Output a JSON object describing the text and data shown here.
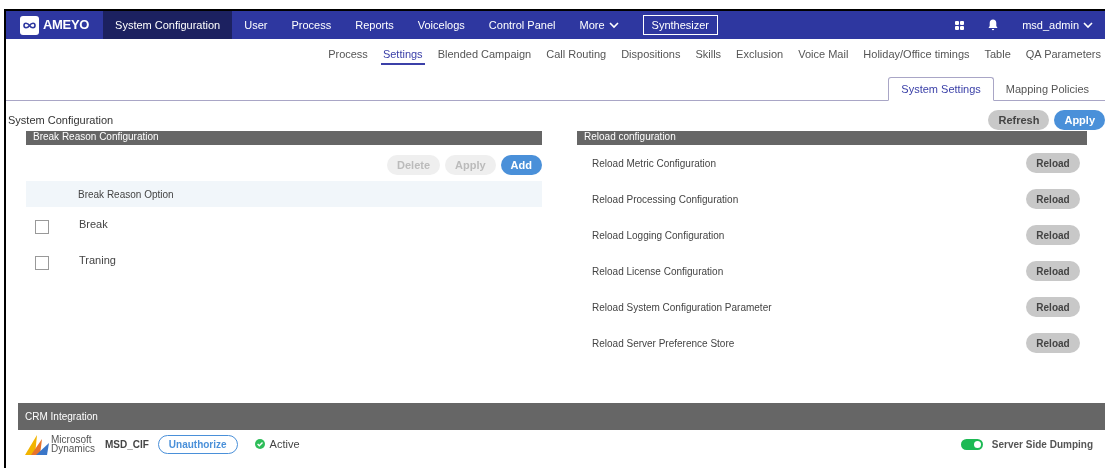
{
  "navbar": {
    "brand": "AMEYO",
    "items": [
      {
        "label": "System Configuration",
        "selected": true
      },
      {
        "label": "User",
        "selected": false
      },
      {
        "label": "Process",
        "selected": false
      },
      {
        "label": "Reports",
        "selected": false
      },
      {
        "label": "Voicelogs",
        "selected": false
      },
      {
        "label": "Control Panel",
        "selected": false
      },
      {
        "label": "More",
        "selected": false,
        "kind": "dropdown"
      },
      {
        "label": "Synthesizer",
        "selected": false,
        "kind": "outlined"
      }
    ],
    "user": "msd_admin"
  },
  "subtabs": [
    {
      "label": "Process",
      "selected": false
    },
    {
      "label": "Settings",
      "selected": true
    },
    {
      "label": "Blended Campaign",
      "selected": false
    },
    {
      "label": "Call Routing",
      "selected": false
    },
    {
      "label": "Dispositions",
      "selected": false
    },
    {
      "label": "Skills",
      "selected": false
    },
    {
      "label": "Exclusion",
      "selected": false
    },
    {
      "label": "Voice Mail",
      "selected": false
    },
    {
      "label": "Holiday/Office timings",
      "selected": false
    },
    {
      "label": "Table",
      "selected": false
    },
    {
      "label": "QA Parameters",
      "selected": false
    }
  ],
  "page_tabs": [
    {
      "label": "System Settings",
      "selected": true
    },
    {
      "label": "Mapping Policies",
      "selected": false
    }
  ],
  "page_title": "System Configuration",
  "page_actions": [
    {
      "label": "Refresh",
      "kind": "secondary"
    },
    {
      "label": "Apply",
      "kind": "primary"
    }
  ],
  "break_reason": {
    "title": "Break Reason Configuration",
    "actions": [
      {
        "label": "Delete",
        "disabled": true
      },
      {
        "label": "Apply",
        "disabled": true
      },
      {
        "label": "Add",
        "disabled": false
      }
    ],
    "column": "Break Reason Option",
    "rows": [
      {
        "label": "Break",
        "checked": false
      },
      {
        "label": "Traning",
        "checked": false
      }
    ]
  },
  "reload": {
    "title": "Reload configuration",
    "rows": [
      {
        "label": "Reload Metric Configuration",
        "button": "Reload"
      },
      {
        "label": "Reload Processing Configuration",
        "button": "Reload"
      },
      {
        "label": "Reload Logging Configuration",
        "button": "Reload"
      },
      {
        "label": "Reload License Configuration",
        "button": "Reload"
      },
      {
        "label": "Reload System Configuration Parameter",
        "button": "Reload"
      },
      {
        "label": "Reload Server Preference Store",
        "button": "Reload"
      }
    ]
  },
  "crm": {
    "title": "CRM Integration",
    "logo_text": [
      "Microsoft",
      "Dynamics"
    ],
    "name": "MSD_CIF",
    "action": "Unauthorize",
    "status": "Active",
    "active": true,
    "toggle": {
      "label": "Server Side Dumping",
      "on": true
    }
  }
}
